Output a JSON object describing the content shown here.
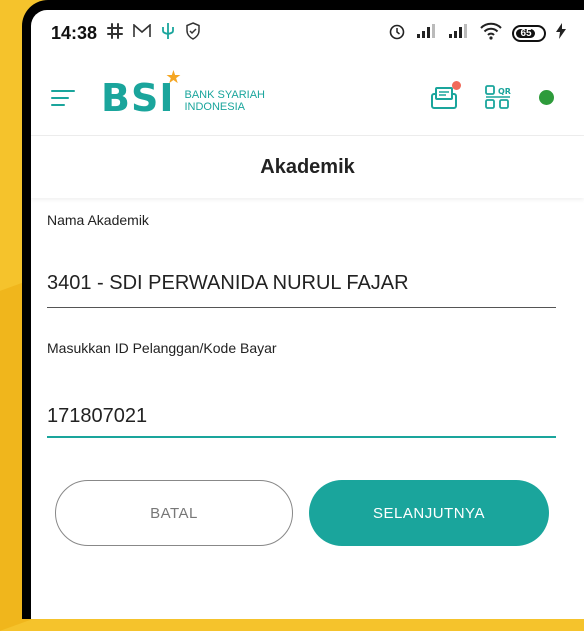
{
  "status_bar": {
    "time": "14:38",
    "left_icons": [
      "slack-icon",
      "gmail-icon",
      "usb-icon",
      "shield-icon"
    ],
    "right_icons": [
      "alarm-icon",
      "signal-icon",
      "signal-icon",
      "wifi-icon"
    ],
    "battery": "65",
    "charging_icon": "bolt-icon"
  },
  "header": {
    "logo_text": "BSI",
    "logo_sub_1": "BANK SYARIAH",
    "logo_sub_2": "INDONESIA",
    "accent_color": "#1aa59c",
    "status_color": "#2e9b3b"
  },
  "page": {
    "title": "Akademik"
  },
  "form": {
    "academic_label": "Nama Akademik",
    "academic_value": "3401 - SDI PERWANIDA NURUL FAJAR",
    "customer_id_label": "Masukkan ID Pelanggan/Kode Bayar",
    "customer_id_value": "171807021"
  },
  "buttons": {
    "cancel": "BATAL",
    "next": "SELANJUTNYA"
  }
}
